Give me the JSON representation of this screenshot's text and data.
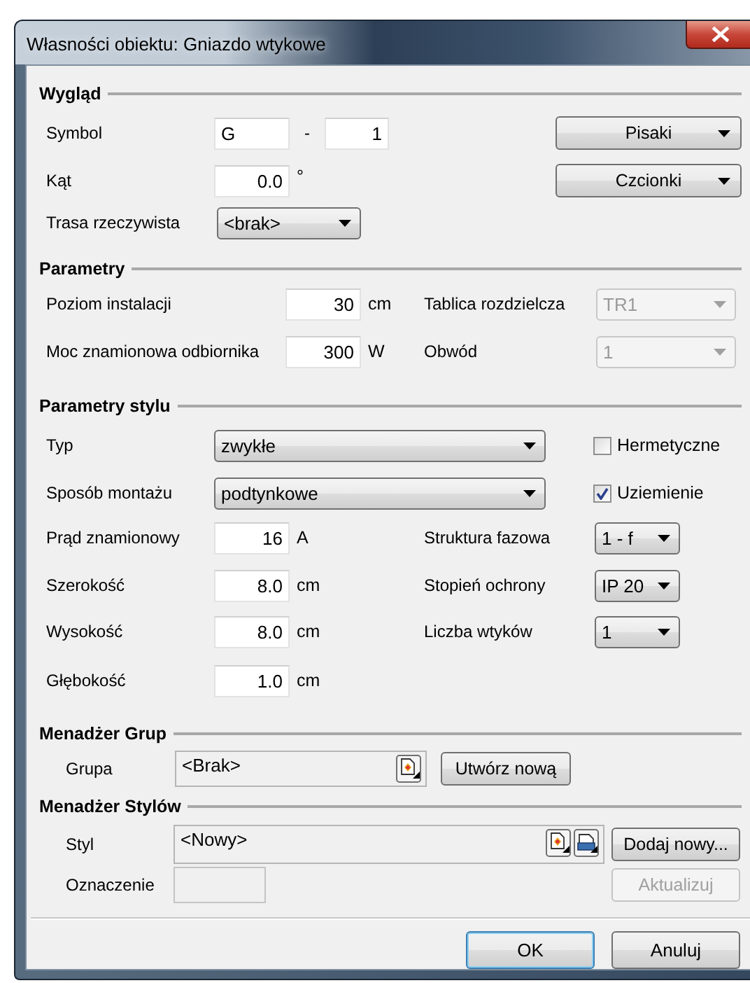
{
  "window": {
    "title": "Własności obiektu: Gniazdo wtykowe"
  },
  "appearance": {
    "title": "Wygląd",
    "symbol": {
      "label": "Symbol",
      "prefix": "G",
      "separator": "-",
      "number": "1"
    },
    "angle": {
      "label": "Kąt",
      "value": "0.0",
      "unit": "°"
    },
    "route": {
      "label": "Trasa rzeczywista",
      "value": "<brak>"
    },
    "buttons": [
      "Pisaki",
      "Czcionki"
    ]
  },
  "parameters": {
    "title": "Parametry",
    "rows": [
      {
        "label": "Poziom instalacji",
        "value": "30",
        "unit": "cm",
        "side_label": "Tablica rozdzielcza",
        "side_value": "TR1",
        "side_disabled": true
      },
      {
        "label": "Moc znamionowa odbiornika",
        "value": "300",
        "unit": "W",
        "side_label": "Obwód",
        "side_value": "1",
        "side_disabled": true
      }
    ]
  },
  "style_parameters": {
    "title": "Parametry stylu",
    "combos": [
      {
        "label": "Typ",
        "value": "zwykłe",
        "option": {
          "label": "Hermetyczne",
          "checked": false
        }
      },
      {
        "label": "Sposób montażu",
        "value": "podtynkowe",
        "option": {
          "label": "Uziemienie",
          "checked": true
        }
      }
    ],
    "fields": [
      {
        "label": "Prąd znamionowy",
        "value": "16",
        "unit": "A",
        "side_label": "Struktura fazowa",
        "side_value": "1 - f"
      },
      {
        "label": "Szerokość",
        "value": "8.0",
        "unit": "cm",
        "side_label": "Stopień ochrony",
        "side_value": "IP 20"
      },
      {
        "label": "Wysokość",
        "value": "8.0",
        "unit": "cm",
        "side_label": "Liczba wtyków",
        "side_value": "1"
      },
      {
        "label": "Głębokość",
        "value": "1.0",
        "unit": "cm"
      }
    ]
  },
  "group_manager": {
    "title": "Menadżer Grup",
    "label": "Grupa",
    "value": "<Brak>",
    "button": "Utwórz nową"
  },
  "style_manager": {
    "title": "Menadżer Stylów",
    "style_label": "Styl",
    "style_value": "<Nowy>",
    "add_button": "Dodaj nowy...",
    "mark_label": "Oznaczenie",
    "mark_disabled": true,
    "update_button": {
      "label": "Aktualizuj",
      "disabled": true
    }
  },
  "footer_buttons": [
    {
      "label": "OK",
      "default": true
    },
    {
      "label": "Anuluj",
      "default": false
    }
  ]
}
